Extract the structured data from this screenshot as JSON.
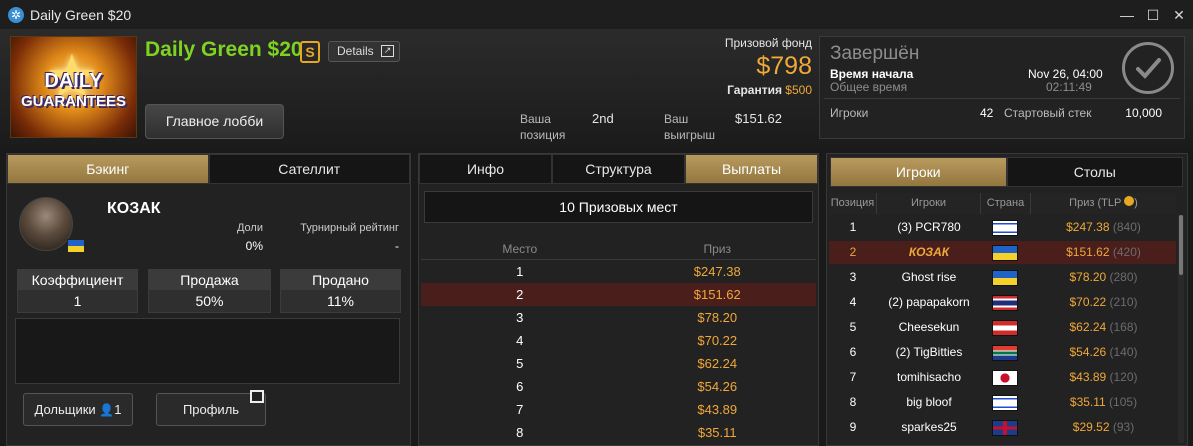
{
  "window": {
    "title": "Daily Green $20",
    "icon": "poker-chip-icon"
  },
  "header": {
    "logo_line1": "DAILY",
    "logo_line2": "GUARANTEES",
    "tournament_name": "Daily Green $20",
    "currency_badge": "S",
    "details_label": "Details",
    "lobby_button": "Главное лобби",
    "position_label": "Ваша позиция",
    "position_value": "2nd",
    "winnings_label": "Ваш выигрыш",
    "winnings_value": "$151.62",
    "prize_pool_label": "Призовой фонд",
    "prize_pool_value": "$798",
    "guarantee_label": "Гарантия",
    "guarantee_value": "$500"
  },
  "status": {
    "title": "Завершён",
    "start_label": "Время начала",
    "start_value": "Nov 26, 04:00",
    "total_label": "Общее время",
    "total_value": "02:11:49",
    "players_label": "Игроки",
    "players_value": "42",
    "stack_label": "Стартовый стек",
    "stack_value": "10,000"
  },
  "left_panel": {
    "tabs": [
      "Бэкинг",
      "Сателлит"
    ],
    "player_name": "КОЗАК",
    "shares_label": "Доли",
    "shares_value": "0%",
    "rating_label": "Турнирный рейтинг",
    "rating_value": "-",
    "coef_label": "Коэффициент",
    "coef_value": "1",
    "sale_label": "Продажа",
    "sale_value": "50%",
    "sold_label": "Продано",
    "sold_value": "11%",
    "backers_button": "Дольщики",
    "backers_count": "1",
    "profile_button": "Профиль"
  },
  "middle_panel": {
    "tabs": [
      "Инфо",
      "Структура",
      "Выплаты"
    ],
    "places_summary": "10 Призовых мест",
    "col_place": "Место",
    "col_prize": "Приз",
    "rows": [
      {
        "place": "1",
        "prize": "$247.38"
      },
      {
        "place": "2",
        "prize": "$151.62"
      },
      {
        "place": "3",
        "prize": "$78.20"
      },
      {
        "place": "4",
        "prize": "$70.22"
      },
      {
        "place": "5",
        "prize": "$62.24"
      },
      {
        "place": "6",
        "prize": "$54.26"
      },
      {
        "place": "7",
        "prize": "$43.89"
      },
      {
        "place": "8",
        "prize": "$35.11"
      }
    ]
  },
  "right_panel": {
    "tabs": [
      "Игроки",
      "Столы"
    ],
    "col_pos": "Позиция",
    "col_player": "Игроки",
    "col_country": "Страна",
    "col_prize": "Приз (TLP",
    "rows": [
      {
        "pos": "1",
        "name": "(3) PCR780",
        "flag": "il",
        "prize": "$247.38",
        "tlp": "(840)"
      },
      {
        "pos": "2",
        "name": "КОЗАК",
        "flag": "ua",
        "prize": "$151.62",
        "tlp": "(420)"
      },
      {
        "pos": "3",
        "name": "Ghost rise",
        "flag": "ua",
        "prize": "$78.20",
        "tlp": "(280)"
      },
      {
        "pos": "4",
        "name": "(2) papapakorn",
        "flag": "th",
        "prize": "$70.22",
        "tlp": "(210)"
      },
      {
        "pos": "5",
        "name": "Cheesekun",
        "flag": "at",
        "prize": "$62.24",
        "tlp": "(168)"
      },
      {
        "pos": "6",
        "name": "(2) TigBitties",
        "flag": "za",
        "prize": "$54.26",
        "tlp": "(140)"
      },
      {
        "pos": "7",
        "name": "tomihisacho",
        "flag": "jp",
        "prize": "$43.89",
        "tlp": "(120)"
      },
      {
        "pos": "8",
        "name": "big bloof",
        "flag": "il",
        "prize": "$35.11",
        "tlp": "(105)"
      },
      {
        "pos": "9",
        "name": "sparkes25",
        "flag": "gb",
        "prize": "$29.52",
        "tlp": "(93)"
      }
    ]
  },
  "colors": {
    "accent_gold": "#b99a5e",
    "prize_orange": "#f0a838",
    "name_green": "#7ed321",
    "highlight_row": "#4a1e1b"
  }
}
